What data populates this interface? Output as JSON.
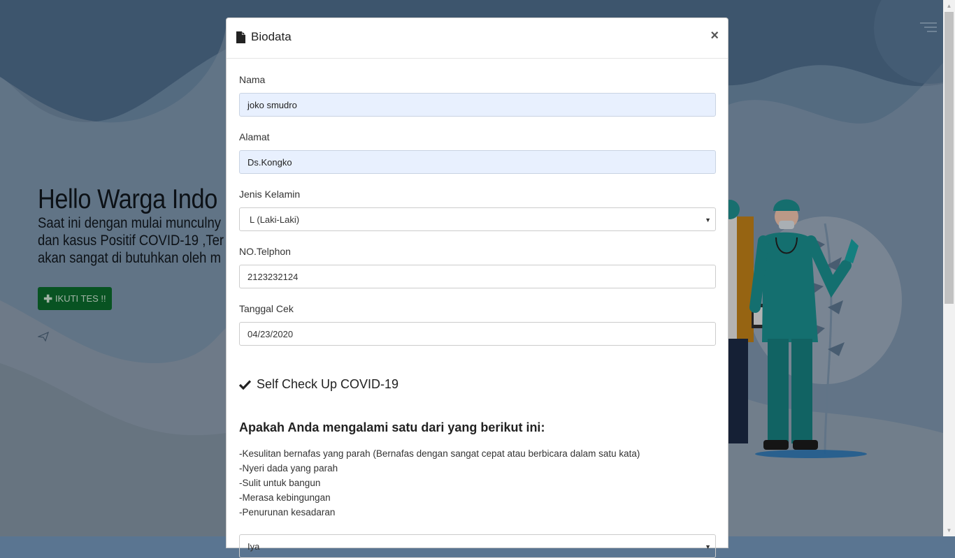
{
  "background": {
    "hero_title": "Hello Warga Indo",
    "hero_lines": [
      "Saat ini dengan mulai munculny",
      "dan kasus Positif COVID-19 ,Ter",
      "akan sangat di butuhkan oleh m"
    ],
    "hero_button_icon": "plus-icon",
    "hero_button_label": "IKUTI TES !!",
    "colors": {
      "accent_green": "#0b6b2c",
      "bg_blue": "#5a7591"
    }
  },
  "modal": {
    "title_icon": "file-icon",
    "title": "Biodata",
    "close_label": "×",
    "fields": {
      "nama_label": "Nama",
      "nama_value": "joko smudro",
      "alamat_label": "Alamat",
      "alamat_value": "Ds.Kongko",
      "jenis_kelamin_label": "Jenis Kelamin",
      "jenis_kelamin_value": "L (Laki-Laki)",
      "telp_label": "NO.Telphon",
      "telp_value": "2123232124",
      "tanggal_label": "Tanggal Cek",
      "tanggal_value": "04/23/2020"
    },
    "check_icon": "checkmark-icon",
    "check_heading": "Self Check Up COVID-19",
    "question": "Apakah Anda mengalami satu dari yang berikut ini:",
    "symptoms": [
      "-Kesulitan bernafas yang parah (Bernafas dengan sangat cepat atau berbicara dalam satu kata)",
      "-Nyeri dada yang parah",
      "-Sulit untuk bangun",
      "-Merasa kebingungan",
      "-Penurunan kesadaran"
    ],
    "answer_value": "Iya"
  }
}
